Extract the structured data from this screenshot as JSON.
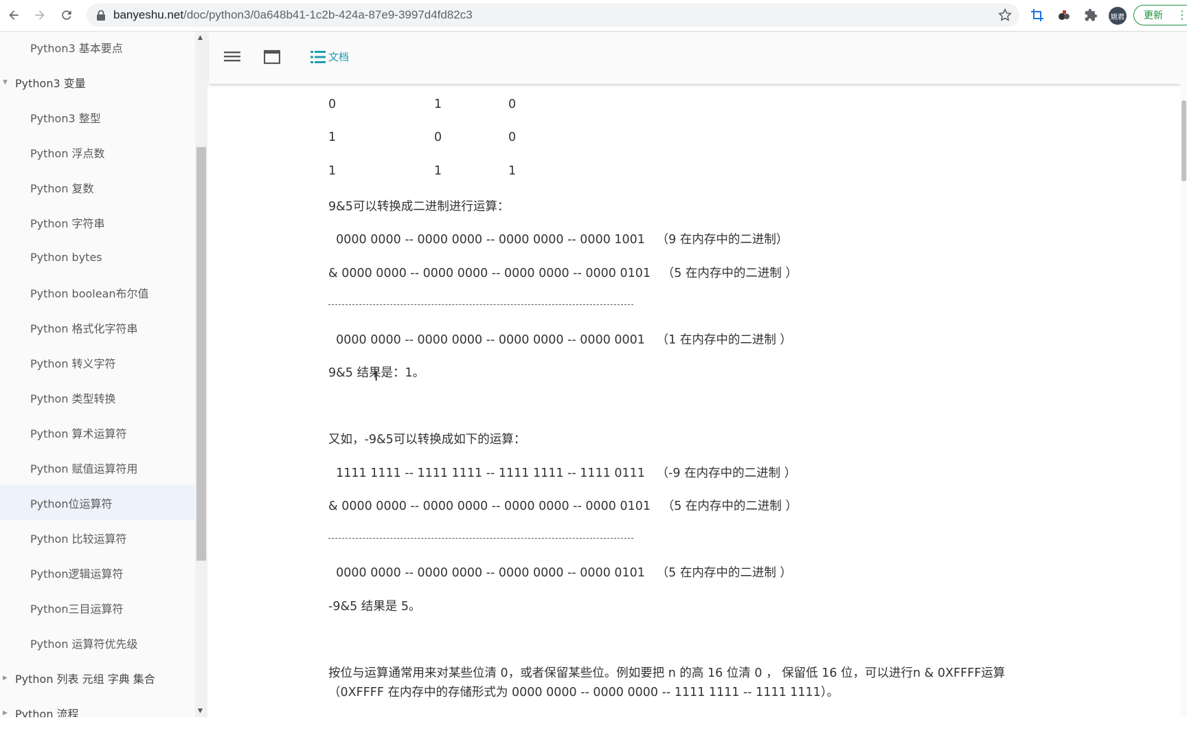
{
  "browser": {
    "url_host": "banyeshu.net",
    "url_path": "/doc/python3/0a648b41-1c2b-424a-87e9-3997d4fd82c3",
    "profile_initials": "姚君",
    "update_label": "更新",
    "icons": [
      "back-icon",
      "forward-icon",
      "reload-icon",
      "lock-icon",
      "star-icon",
      "crop-icon",
      "extension-icon",
      "puzzle-icon",
      "more-icon"
    ]
  },
  "sidebar": {
    "items": [
      {
        "label": "Python3 基本要点",
        "level": 2
      },
      {
        "label": "Python3 变量",
        "level": 1,
        "expanded": true
      },
      {
        "label": "Python3 整型",
        "level": 2
      },
      {
        "label": "Python 浮点数",
        "level": 2
      },
      {
        "label": "Python 复数",
        "level": 2
      },
      {
        "label": "Python 字符串",
        "level": 2
      },
      {
        "label": "Python bytes",
        "level": 2
      },
      {
        "label": "Python boolean布尔值",
        "level": 2
      },
      {
        "label": "Python 格式化字符串",
        "level": 2
      },
      {
        "label": "Python 转义字符",
        "level": 2
      },
      {
        "label": "Python 类型转换",
        "level": 2
      },
      {
        "label": "Python 算术运算符",
        "level": 2
      },
      {
        "label": "Python 赋值运算符用",
        "level": 2
      },
      {
        "label": "Python位运算符",
        "level": 2,
        "active": true
      },
      {
        "label": "Python 比较运算符",
        "level": 2
      },
      {
        "label": "Python逻辑运算符",
        "level": 2
      },
      {
        "label": "Python三目运算符",
        "level": 2
      },
      {
        "label": "Python 运算符优先级",
        "level": 2
      },
      {
        "label": "Python 列表 元组 字典 集合",
        "level": 1,
        "expanded": false
      },
      {
        "label": "Python 流程",
        "level": 1,
        "expanded": false
      }
    ]
  },
  "toolbar": {
    "doc_label": "文档"
  },
  "content": {
    "truth_rows": [
      [
        "0",
        "1",
        "0"
      ],
      [
        "1",
        "0",
        "0"
      ],
      [
        "1",
        "1",
        "1"
      ]
    ],
    "lines": {
      "l1": "9&5可以转换成二进制进行运算：",
      "l2": "  0000 0000 -- 0000 0000 -- 0000 0000 -- 0000 1001   （9 在内存中的二进制）",
      "l3": "& 0000 0000 -- 0000 0000 -- 0000 0000 -- 0000 0101   （5 在内存中的二进制 ）",
      "l4": "  0000 0000 -- 0000 0000 -- 0000 0000 -- 0000 0001   （1 在内存中的二进制 ）",
      "l5": "9&5 结果是：1。",
      "l6": "又如，-9&5可以转换成如下的运算：",
      "l7": "  1111 1111 -- 1111 1111 -- 1111 1111 -- 1111 0111   （-9 在内存中的二进制 ）",
      "l8": "& 0000 0000 -- 0000 0000 -- 0000 0000 -- 0000 0101   （5 在内存中的二进制 ）",
      "l9": "  0000 0000 -- 0000 0000 -- 0000 0000 -- 0000 0101   （5 在内存中的二进制 ）",
      "l10": "-9&5 结果是 5。",
      "l11": "按位与运算通常用来对某些位清 0，或者保留某些位。例如要把 n 的高 16 位清 0 ， 保留低 16 位，可以进行n & 0XFFFF运算",
      "l12": "（0XFFFF 在内存中的存储形式为 0000 0000 -- 0000 0000 -- 1111 1111 -- 1111 1111）。"
    }
  }
}
